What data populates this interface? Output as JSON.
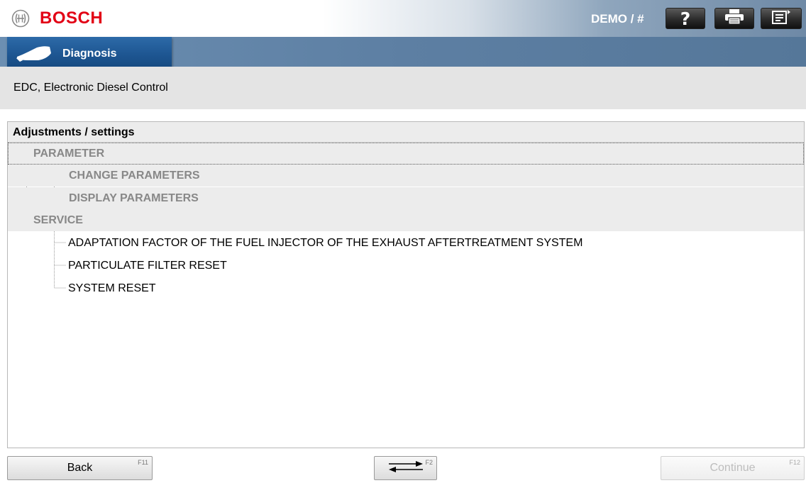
{
  "header": {
    "brand": "BOSCH",
    "logo_icon": "bosch-armature-icon",
    "session": "DEMO / #",
    "buttons": [
      {
        "name": "help",
        "icon": "question-icon",
        "glyph": "?"
      },
      {
        "name": "print",
        "icon": "printer-icon"
      },
      {
        "name": "menu",
        "icon": "menu-export-icon"
      }
    ]
  },
  "nav": {
    "tab_label": "Diagnosis",
    "tab_icon": "obd-connector-icon"
  },
  "context": {
    "title": "EDC, Electronic Diesel Control"
  },
  "panel": {
    "heading": "Adjustments / settings",
    "tree": [
      {
        "label": "PARAMETER",
        "type": "node",
        "expanded": true,
        "level": 0,
        "selected": true
      },
      {
        "label": "CHANGE PARAMETERS",
        "type": "node",
        "expanded": false,
        "level": 1
      },
      {
        "label": "DISPLAY PARAMETERS",
        "type": "node",
        "expanded": false,
        "level": 1
      },
      {
        "label": "SERVICE",
        "type": "node",
        "expanded": true,
        "level": 0
      },
      {
        "label": "ADAPTATION FACTOR OF THE FUEL INJECTOR OF THE EXHAUST AFTERTREATMENT SYSTEM",
        "type": "leaf",
        "level": 1
      },
      {
        "label": "PARTICULATE FILTER RESET",
        "type": "leaf",
        "level": 1
      },
      {
        "label": "SYSTEM RESET",
        "type": "leaf",
        "level": 1
      }
    ]
  },
  "footer": {
    "back": {
      "label": "Back",
      "key": "F11",
      "enabled": true
    },
    "swap": {
      "icon": "swap-arrows-icon",
      "key": "F2",
      "enabled": true
    },
    "continue": {
      "label": "Continue",
      "key": "F12",
      "enabled": false
    }
  },
  "colors": {
    "brand_red": "#e20015",
    "tab_blue": "#1e5793",
    "nav_blue": "#5d7fa3",
    "node_gray": "#888888"
  }
}
